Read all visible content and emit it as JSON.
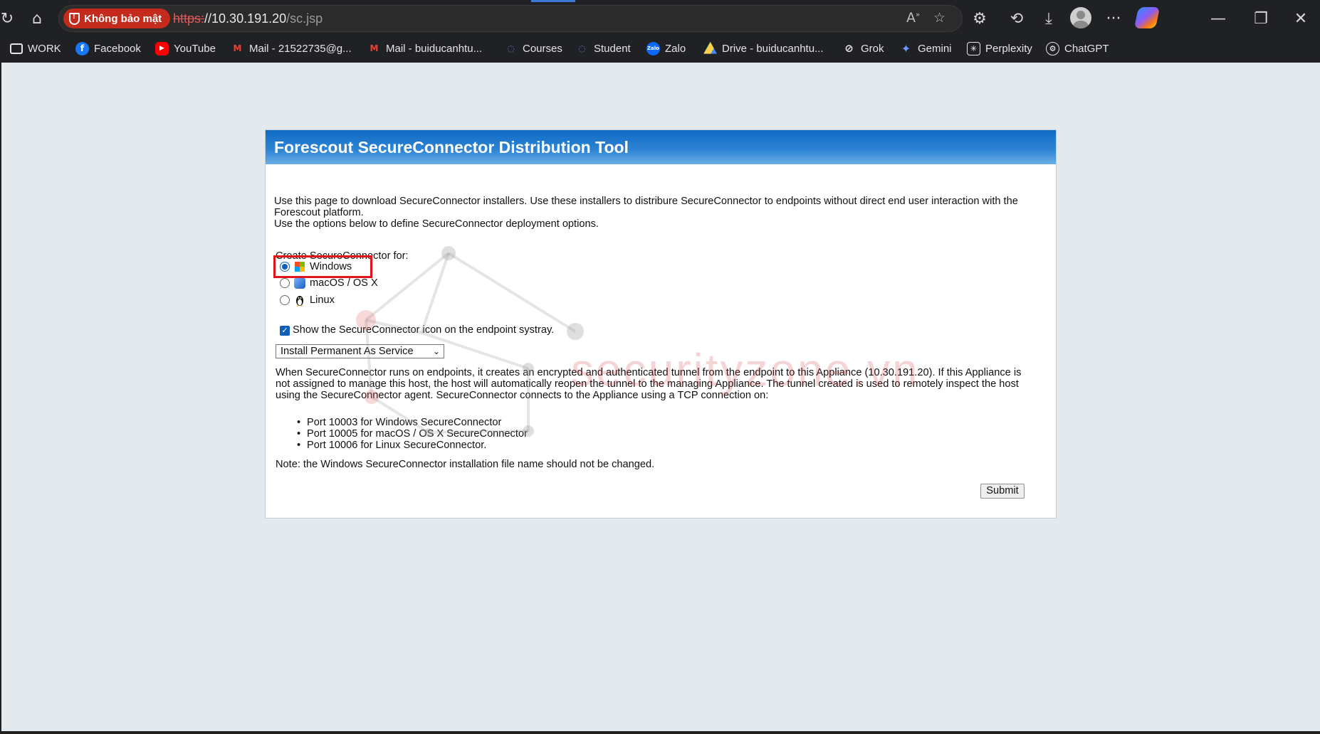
{
  "browser": {
    "security_badge": "Không bảo mật",
    "url_scheme": "https:",
    "url_host": "//10.30.191.20",
    "url_path": "/sc.jsp"
  },
  "bookmarks": [
    {
      "label": "WORK",
      "icon": "folder-icon"
    },
    {
      "label": "Facebook",
      "icon": "facebook-icon"
    },
    {
      "label": "YouTube",
      "icon": "youtube-icon"
    },
    {
      "label": "Mail - 21522735@g...",
      "icon": "gmail-icon"
    },
    {
      "label": "Mail - buiducanhtu...",
      "icon": "gmail-icon"
    },
    {
      "label": "Courses",
      "icon": "courses-icon"
    },
    {
      "label": "Student",
      "icon": "student-icon"
    },
    {
      "label": "Zalo",
      "icon": "zalo-icon"
    },
    {
      "label": "Drive - buiducanhtu...",
      "icon": "drive-icon"
    },
    {
      "label": "Grok",
      "icon": "grok-icon"
    },
    {
      "label": "Gemini",
      "icon": "gemini-icon"
    },
    {
      "label": "Perplexity",
      "icon": "perplexity-icon"
    },
    {
      "label": "ChatGPT",
      "icon": "chatgpt-icon"
    }
  ],
  "page": {
    "title": "Forescout SecureConnector Distribution Tool",
    "intro_line1": "Use this page to download SecureConnector installers. Use these installers to distribure SecureConnector to endpoints without direct end user interaction with the",
    "intro_line2": "Forescout platform.",
    "intro_line3": "Use the options below to define SecureConnector deployment options.",
    "create_label": "Create SecureConnector for:",
    "os_options": [
      {
        "label": "Windows",
        "checked": true
      },
      {
        "label": "macOS / OS X",
        "checked": false
      },
      {
        "label": "Linux",
        "checked": false
      }
    ],
    "systray_label": "Show the SecureConnector icon on the endpoint systray.",
    "systray_checked": true,
    "install_mode": "Install Permanent As Service",
    "para_line1": "When SecureConnector runs on endpoints, it creates an encrypted and authenticated tunnel from the endpoint to this Appliance (10.30.191.20). If this Appliance is",
    "para_line2": "not assigned to manage this host, the host will automatically reopen the tunnel to the managing Appliance. The tunnel created is used to remotely inspect the host",
    "para_line3": "using the SecureConnector agent. SecureConnector connects to the Appliance using a TCP connection on:",
    "ports": [
      "Port 10003 for Windows SecureConnector",
      "Port 10005 for macOS / OS X SecureConnector",
      "Port 10006 for Linux SecureConnector."
    ],
    "note": "Note: the Windows SecureConnector installation file name should not be changed.",
    "submit_label": "Submit"
  },
  "watermark": "securityzone.vn",
  "colors": {
    "header_blue": "#1a75cc",
    "highlight_red": "#e0151c",
    "page_bg": "#e3e9ed"
  }
}
